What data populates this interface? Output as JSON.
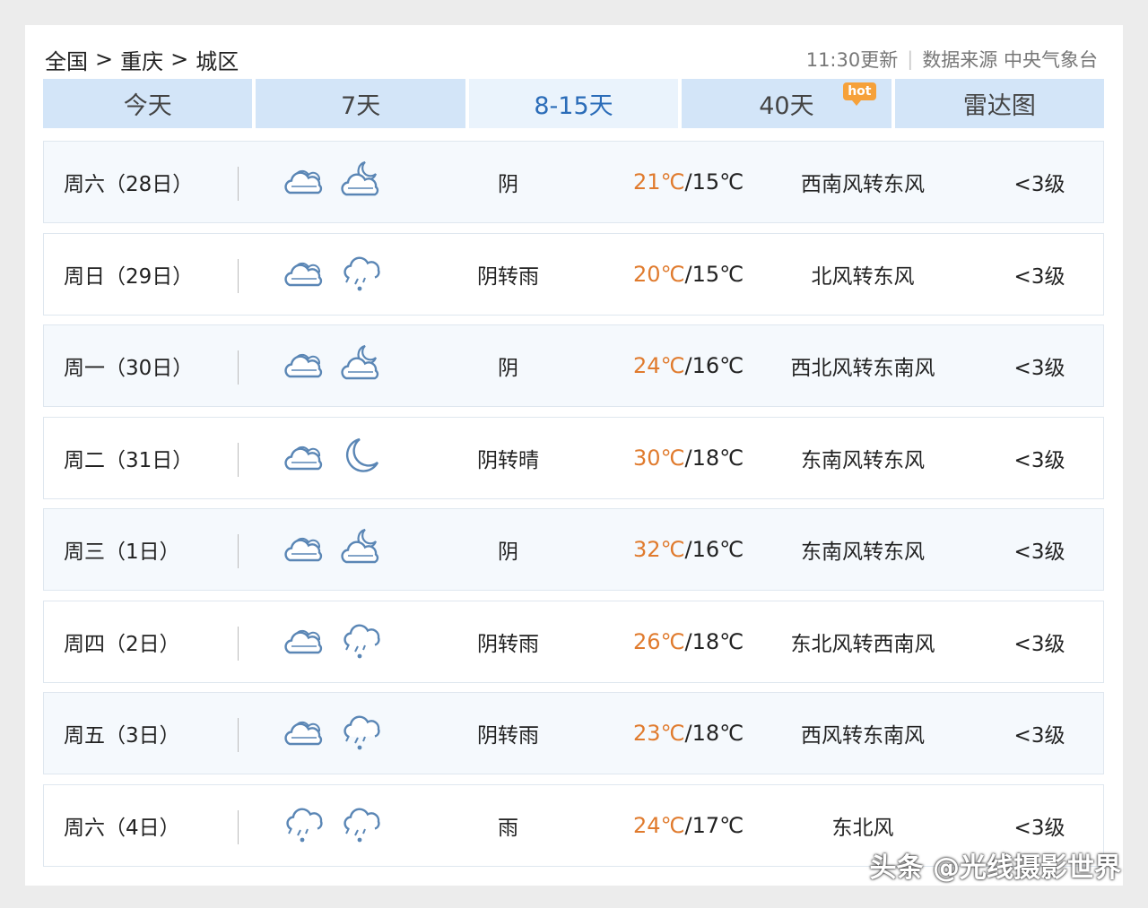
{
  "breadcrumb": [
    "全国",
    "重庆",
    "城区"
  ],
  "breadcrumb_sep": ">",
  "update_time": "11:30更新",
  "source_label": "数据来源 中央气象台",
  "tabs": [
    {
      "label": "今天"
    },
    {
      "label": "7天"
    },
    {
      "label": "8-15天"
    },
    {
      "label": "40天",
      "badge": "hot"
    },
    {
      "label": "雷达图"
    }
  ],
  "active_tab": 2,
  "forecast": [
    {
      "day": "周六（28日）",
      "icons": [
        "cloud-icon",
        "partly-cloudy-night-icon"
      ],
      "desc": "阴",
      "high": "21℃",
      "low": "15℃",
      "wind": "西南风转东风",
      "level": "<3级"
    },
    {
      "day": "周日（29日）",
      "icons": [
        "cloud-icon",
        "rain-icon"
      ],
      "desc": "阴转雨",
      "high": "20℃",
      "low": "15℃",
      "wind": "北风转东风",
      "level": "<3级"
    },
    {
      "day": "周一（30日）",
      "icons": [
        "cloud-icon",
        "partly-cloudy-night-icon"
      ],
      "desc": "阴",
      "high": "24℃",
      "low": "16℃",
      "wind": "西北风转东南风",
      "level": "<3级"
    },
    {
      "day": "周二（31日）",
      "icons": [
        "cloud-icon",
        "moon-icon"
      ],
      "desc": "阴转晴",
      "high": "30℃",
      "low": "18℃",
      "wind": "东南风转东风",
      "level": "<3级"
    },
    {
      "day": "周三（1日）",
      "icons": [
        "cloud-icon",
        "partly-cloudy-night-icon"
      ],
      "desc": "阴",
      "high": "32℃",
      "low": "16℃",
      "wind": "东南风转东风",
      "level": "<3级"
    },
    {
      "day": "周四（2日）",
      "icons": [
        "cloud-icon",
        "rain-icon"
      ],
      "desc": "阴转雨",
      "high": "26℃",
      "low": "18℃",
      "wind": "东北风转西南风",
      "level": "<3级"
    },
    {
      "day": "周五（3日）",
      "icons": [
        "cloud-icon",
        "rain-icon"
      ],
      "desc": "阴转雨",
      "high": "23℃",
      "low": "18℃",
      "wind": "西风转东南风",
      "level": "<3级"
    },
    {
      "day": "周六（4日）",
      "icons": [
        "rain-icon",
        "rain-icon"
      ],
      "desc": "雨",
      "high": "24℃",
      "low": "17℃",
      "wind": "东北风",
      "level": "<3级"
    }
  ],
  "temp_separator": "/",
  "watermark": "头条 @光线摄影世界",
  "colors": {
    "high_temp": "#e07b2e",
    "tab_bg": "#d3e5f8",
    "tab_active_text": "#2b6cb8",
    "icon_stroke": "#5a86b5"
  }
}
